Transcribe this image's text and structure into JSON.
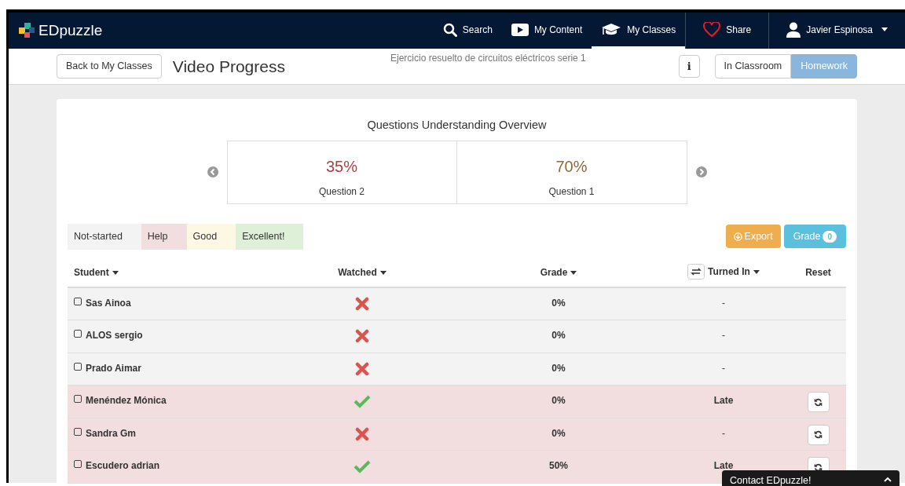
{
  "brand": {
    "name": "EDpuzzle"
  },
  "nav": [
    {
      "kind": "search",
      "label": "Search",
      "selected": false
    },
    {
      "kind": "content",
      "label": "My Content",
      "selected": false
    },
    {
      "kind": "classes",
      "label": "My Classes",
      "selected": true
    },
    {
      "kind": "share",
      "label": "Share",
      "selected": false
    },
    {
      "kind": "user",
      "label": "Javier Espinosa",
      "selected": false
    }
  ],
  "subheader": {
    "back_button": "Back to My Classes",
    "title": "Video Progress",
    "video_title": "Ejercicio resuelto de circuitos eléctricos serie 1",
    "info_button": "i",
    "modes": [
      {
        "label": "In Classroom",
        "selected": false
      },
      {
        "label": "Homework",
        "selected": true
      }
    ]
  },
  "overview": {
    "title": "Questions Understanding Overview",
    "questions": [
      {
        "percent": "35%",
        "label": "Question 2",
        "color": "#a94442"
      },
      {
        "percent": "70%",
        "label": "Question 1",
        "color": "#8a6d3b"
      }
    ]
  },
  "legend": [
    {
      "label": "Not-started",
      "color": "#f3f3f3"
    },
    {
      "label": "Help",
      "color": "#f2dede"
    },
    {
      "label": "Good",
      "color": "#fcf8e3"
    },
    {
      "label": "Excellent!",
      "color": "#dff0d8"
    }
  ],
  "actions": {
    "export": "Export",
    "grade": "Grade",
    "grade_count": "0"
  },
  "table": {
    "columns": [
      "Student",
      "Watched",
      "Grade",
      "Turned In",
      "Reset"
    ],
    "rows": [
      {
        "student": "Sas Ainoa",
        "checked": false,
        "watched": false,
        "grade": "0%",
        "turned_in": "-",
        "reset": false,
        "color": "#f3f3f3"
      },
      {
        "student": "ALOS sergio",
        "checked": false,
        "watched": false,
        "grade": "0%",
        "turned_in": "-",
        "reset": false,
        "color": "#f3f3f3"
      },
      {
        "student": "Prado Aimar",
        "checked": false,
        "watched": false,
        "grade": "0%",
        "turned_in": "-",
        "reset": false,
        "color": "#f3f3f3"
      },
      {
        "student": "Menéndez Mónica",
        "checked": false,
        "watched": true,
        "grade": "0%",
        "turned_in": "Late",
        "reset": true,
        "color": "#f2dede"
      },
      {
        "student": "Sandra Gm",
        "checked": false,
        "watched": false,
        "grade": "0%",
        "turned_in": "-",
        "reset": true,
        "color": "#f2dede"
      },
      {
        "student": "Escudero adrian",
        "checked": false,
        "watched": true,
        "grade": "50%",
        "turned_in": "Late",
        "reset": true,
        "color": "#f2dede"
      }
    ]
  },
  "contact_widget": {
    "label": "Contact EDpuzzle!"
  }
}
